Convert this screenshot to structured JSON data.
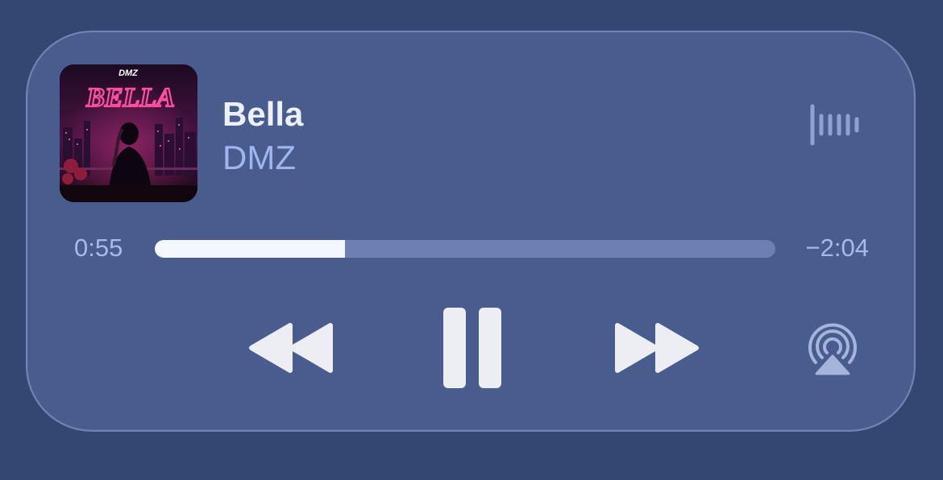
{
  "track": {
    "title": "Bella",
    "artist": "DMZ",
    "artwork": {
      "artist_text": "DMZ",
      "title_text": "BELLA"
    }
  },
  "playback": {
    "elapsed": "0:55",
    "remaining": "−2:04",
    "progress": 0.306,
    "state": "playing"
  },
  "icons": {
    "waveform": "waveform-icon",
    "rewind": "rewind-icon",
    "pause": "pause-icon",
    "forward": "fast-forward-icon",
    "airplay": "airplay-audio-icon"
  },
  "colors": {
    "background": "#334772",
    "widget": "#485d8d",
    "title": "#ecf0fa",
    "artist": "#9fb5ee",
    "progress_fill": "#f3f8ff",
    "progress_track": "#6c80b3",
    "controls": "#eceef3"
  }
}
